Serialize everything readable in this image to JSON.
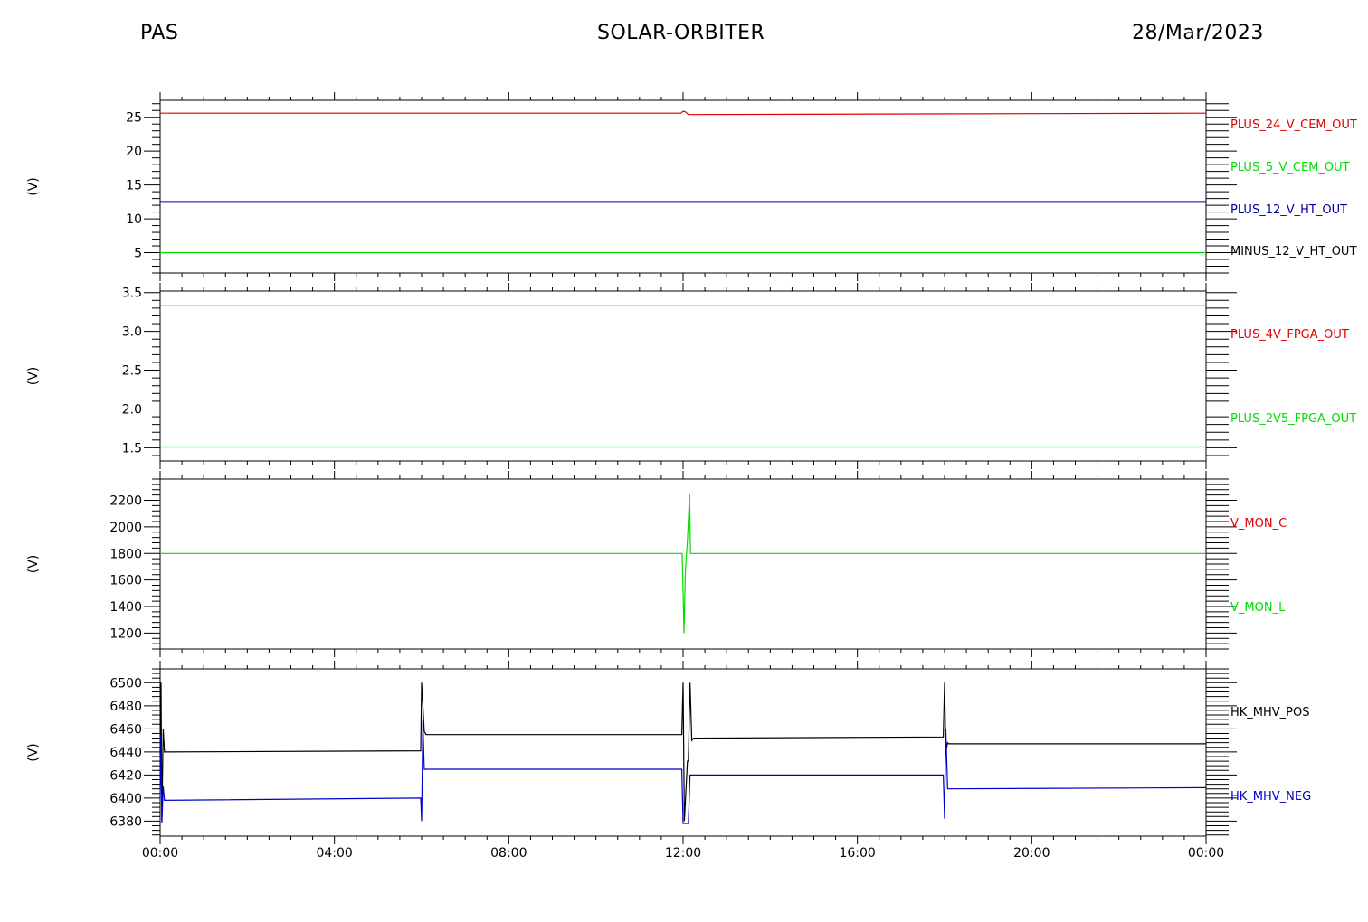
{
  "header": {
    "left": "PAS",
    "center": "SOLAR-ORBITER",
    "right": "28/Mar/2023"
  },
  "chart_data": [
    {
      "type": "line",
      "ylabel": "(V)",
      "ylim": [
        2,
        27.5
      ],
      "yticks": [
        5,
        10,
        15,
        20,
        25
      ],
      "tick_labels": [
        "5",
        "10",
        "15",
        "20",
        "25"
      ],
      "xlim": [
        0,
        24
      ],
      "series": [
        {
          "name": "PLUS_24_V_CEM_OUT",
          "color": "#e00000",
          "x": [
            0,
            11.95,
            12.0,
            12.05,
            12.12,
            24
          ],
          "y": [
            25.6,
            25.6,
            25.9,
            25.8,
            25.4,
            25.6
          ]
        },
        {
          "name": "PLUS_5_V_CEM_OUT",
          "color": "#00dd00",
          "x": [
            0,
            24
          ],
          "y": [
            5.0,
            5.0
          ]
        },
        {
          "name": "PLUS_12_V_HT_OUT",
          "color": "#0000a0",
          "x": [
            0,
            24
          ],
          "y": [
            12.5,
            12.5
          ]
        },
        {
          "name": "MINUS_12_V_HT_OUT",
          "color": "#000000",
          "x": [],
          "y": []
        }
      ]
    },
    {
      "type": "line",
      "ylabel": "(V)",
      "ylim": [
        1.33,
        3.52
      ],
      "yticks": [
        1.5,
        2.0,
        2.5,
        3.0,
        3.5
      ],
      "tick_labels": [
        "1.5",
        "2.0",
        "2.5",
        "3.0",
        "3.5"
      ],
      "xlim": [
        0,
        24
      ],
      "series": [
        {
          "name": "PLUS_4V_FPGA_OUT",
          "color": "#e00000",
          "x": [
            0,
            24
          ],
          "y": [
            3.33,
            3.33
          ]
        },
        {
          "name": "PLUS_2V5_FPGA_OUT",
          "color": "#00dd00",
          "x": [
            0,
            24
          ],
          "y": [
            1.51,
            1.51
          ]
        }
      ]
    },
    {
      "type": "line",
      "ylabel": "(V)",
      "ylim": [
        1080,
        2360
      ],
      "yticks": [
        1200,
        1400,
        1600,
        1800,
        2000,
        2200
      ],
      "tick_labels": [
        "1200",
        "1400",
        "1600",
        "1800",
        "2000",
        "2200"
      ],
      "xlim": [
        0,
        24
      ],
      "series": [
        {
          "name": "V_MON_C",
          "color": "#e00000",
          "x": [],
          "y": []
        },
        {
          "name": "V_MON_L",
          "color": "#00dd00",
          "x": [
            0,
            11.98,
            12.02,
            12.05,
            12.1,
            12.15,
            12.17,
            12.2,
            24
          ],
          "y": [
            1800,
            1800,
            1200,
            1650,
            1900,
            2250,
            1800,
            1800,
            1800
          ]
        }
      ]
    },
    {
      "type": "line",
      "ylabel": "(V)",
      "ylim": [
        6367,
        6512
      ],
      "yticks": [
        6380,
        6400,
        6420,
        6440,
        6460,
        6480,
        6500
      ],
      "tick_labels": [
        "6380",
        "6400",
        "6420",
        "6440",
        "6460",
        "6480",
        "6500"
      ],
      "xlim": [
        0,
        24
      ],
      "xticks": [
        0,
        4,
        8,
        12,
        16,
        20,
        24
      ],
      "xtick_labels": [
        "00:00",
        "04:00",
        "08:00",
        "12:00",
        "16:00",
        "20:00",
        "00:00"
      ],
      "series": [
        {
          "name": "HK_MHV_POS",
          "color": "#000000",
          "x": [
            0,
            0.02,
            0.04,
            0.07,
            0.1,
            5.98,
            6.0,
            6.03,
            6.06,
            6.1,
            11.97,
            12.0,
            12.03,
            12.1,
            12.12,
            12.16,
            12.2,
            12.24,
            17.97,
            18.0,
            18.03,
            18.07,
            18.1,
            24
          ],
          "y": [
            6438,
            6500,
            6380,
            6460,
            6440,
            6441,
            6500,
            6480,
            6458,
            6455,
            6455,
            6500,
            6380,
            6432,
            6432,
            6500,
            6450,
            6452,
            6453,
            6500,
            6440,
            6448,
            6447,
            6447
          ]
        },
        {
          "name": "HK_MHV_NEG",
          "color": "#0000cc",
          "x": [
            0,
            0.02,
            0.04,
            0.07,
            0.1,
            5.98,
            6.0,
            6.03,
            6.06,
            6.1,
            11.97,
            12.0,
            12.03,
            12.12,
            12.16,
            12.2,
            12.24,
            17.97,
            18.0,
            18.03,
            18.07,
            18.1,
            24
          ],
          "y": [
            6398,
            6455,
            6378,
            6410,
            6398,
            6400,
            6380,
            6468,
            6425,
            6425,
            6425,
            6378,
            6378,
            6378,
            6420,
            6420,
            6420,
            6420,
            6382,
            6460,
            6408,
            6408,
            6409
          ]
        }
      ]
    }
  ]
}
